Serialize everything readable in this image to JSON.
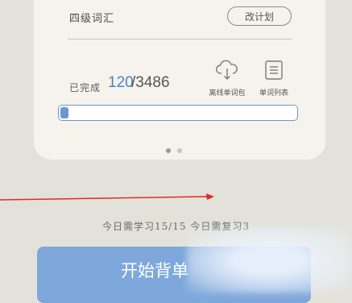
{
  "plan": {
    "vocab_title": "四级词汇",
    "change_plan_label": "改计划"
  },
  "progress": {
    "done_label": "已完成",
    "done_count": "120",
    "total_count": "/3486",
    "fraction": 0.0344
  },
  "tools": {
    "offline_label": "离线单词包",
    "list_label": "单词列表"
  },
  "pager": {
    "count": 2,
    "active_index": 0
  },
  "today": {
    "stats_text": "今日需学习15/15 今日需复习3"
  },
  "start_button": {
    "label": "开始背单"
  },
  "colors": {
    "accent": "#4b80c4",
    "button": "#7ea8dc",
    "arrow": "#e02a2a",
    "background": "#e3e2da",
    "card": "#f6f3ec"
  }
}
